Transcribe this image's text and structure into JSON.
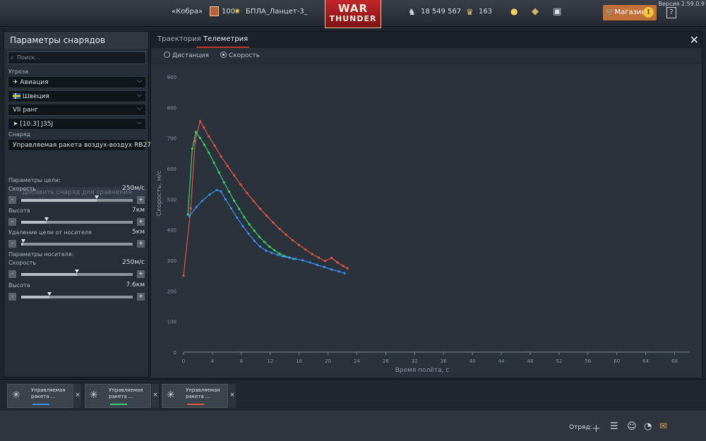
{
  "topbar": {
    "nickname": "«Кобра»",
    "rank": "100",
    "vehicle": "БПЛА_Ланцет-3_",
    "logo_line1": "WAR",
    "logo_line2": "THUNDER",
    "silver_lions": "18 549 567",
    "golden_eagles": "163",
    "shop_label": "Магазин",
    "warn": "!",
    "help": "?",
    "version": "Версия 2.59.0.9"
  },
  "left": {
    "title": "Параметры снарядов",
    "search_placeholder": "Поиск...",
    "threat_label": "Угроза",
    "type_value": "Авиация",
    "country_value": "Швеция",
    "rank_value": "VII ранг",
    "vehicle_value": "[10.3] J35J",
    "shell_label": "Снаряд",
    "shell_value": "Управляемая ракета воздух-воздух RB27",
    "add_button": "Добавить снаряд для сравнения",
    "target_params": "Параметры цели:",
    "carrier_params": "Параметры носителя:",
    "sliders": [
      {
        "label": "Скорость",
        "value": "250м/с",
        "level": 0.68
      },
      {
        "label": "Высота",
        "value": "7км",
        "level": 0.23
      },
      {
        "label": "Удаление цели от носителя",
        "value": "5км",
        "level": 0.02
      },
      {
        "label": "Скорость",
        "value": "250м/с",
        "level": 0.5
      },
      {
        "label": "Высота",
        "value": "7.6км",
        "level": 0.25
      }
    ],
    "minus": "-",
    "plus": "+"
  },
  "main": {
    "tabs": [
      "Траектория",
      "Телеметрия"
    ],
    "radios": [
      "Дистанция",
      "Скорость"
    ],
    "close": "✕"
  },
  "chart_data": {
    "type": "line",
    "xlabel": "Время полёта, с",
    "ylabel": "Скорость, м/с",
    "xlim": [
      0,
      70
    ],
    "ylim": [
      0,
      900
    ],
    "xticks": [
      0,
      4,
      8,
      12,
      16,
      20,
      24,
      28,
      32,
      36,
      40,
      44,
      48,
      52,
      56,
      60,
      64,
      68
    ],
    "yticks": [
      0,
      100,
      200,
      300,
      400,
      500,
      600,
      700,
      800,
      900
    ],
    "series": [
      {
        "color": "#e8553f",
        "x": [
          0,
          1,
          1.6,
          2.3,
          2.8,
          3.5,
          4.3,
          5.2,
          6.1,
          7.0,
          7.9,
          8.8,
          9.7,
          10.6,
          11.5,
          12.4,
          13.3,
          14.2,
          15.1,
          16.0,
          16.9,
          17.8,
          18.7,
          19.6,
          20.5,
          21.3,
          22.1,
          22.7
        ],
        "y": [
          250,
          470,
          690,
          755,
          735,
          705,
          675,
          640,
          608,
          578,
          548,
          520,
          494,
          469,
          446,
          424,
          403,
          384,
          366,
          350,
          335,
          321,
          309,
          298,
          308,
          293,
          282,
          274
        ]
      },
      {
        "color": "#3bd16f",
        "x": [
          0.6,
          1.2,
          1.7,
          2.3,
          2.9,
          3.5,
          4.2,
          4.9,
          5.6,
          6.3,
          7.0,
          7.7,
          8.4,
          9.1,
          9.8,
          10.5,
          11.2,
          11.9,
          12.6,
          13.3,
          14.0,
          14.7,
          15.2
        ],
        "y": [
          450,
          665,
          720,
          700,
          678,
          652,
          620,
          588,
          555,
          525,
          495,
          468,
          442,
          418,
          397,
          377,
          360,
          345,
          333,
          322,
          314,
          309,
          305
        ]
      },
      {
        "color": "#3d8ef2",
        "x": [
          0.8,
          1.8,
          2.6,
          3.6,
          4.6,
          5.2,
          5.8,
          6.6,
          7.4,
          8.2,
          9.0,
          9.8,
          10.6,
          11.4,
          12.2,
          13.0,
          13.8,
          14.6,
          15.5,
          16.5,
          17.5,
          18.5,
          19.5,
          20.5,
          21.5,
          22.3
        ],
        "y": [
          445,
          475,
          495,
          515,
          530,
          525,
          500,
          470,
          440,
          412,
          387,
          364,
          345,
          332,
          325,
          318,
          312,
          309,
          305,
          300,
          293,
          285,
          278,
          270,
          264,
          258
        ]
      }
    ]
  },
  "bottom": {
    "cards": [
      {
        "title": "Управляемая ракета ...",
        "color": "#3d8ef2"
      },
      {
        "title": "Управляемая ракета ...",
        "color": "#3bd16f"
      },
      {
        "title": "Управляемая ракета ...",
        "color": "#e8553f"
      }
    ],
    "close": "×"
  },
  "footer": {
    "squad_label": "Отряд:"
  }
}
